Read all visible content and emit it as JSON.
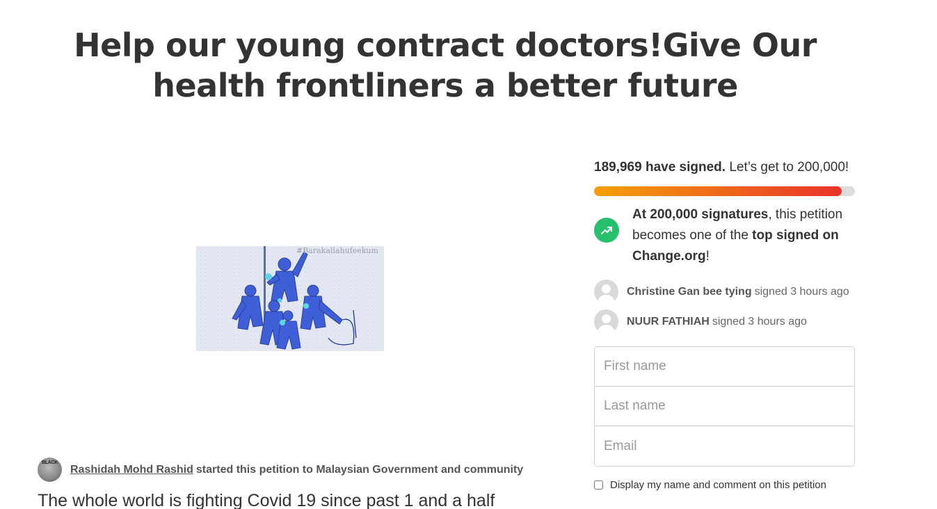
{
  "petition": {
    "title": "Help our young contract doctors!Give Our health frontliners a better future",
    "image_watermark": "#Barakallahufeekum",
    "starter": {
      "avatar_text": "BLACK",
      "name": "Rashidah Mohd Rashid",
      "action_text": "started this petition to Malaysian Government and community"
    },
    "body_preview": "The whole world is fighting Covid 19 since past 1 and a half"
  },
  "progress": {
    "signed_count": "189,969 have signed.",
    "goal_text": "Let’s get to 200,000!",
    "fraction": 0.95,
    "colors": {
      "start": "#f5a00a",
      "end": "#e8332a",
      "track": "#dddddd"
    }
  },
  "milestone": {
    "icon": "trending-up-icon",
    "lead": "At 200,000 signatures",
    "middle": ", this petition becomes one of the",
    "emphasis": "top signed on Change.org",
    "tail": "!",
    "icon_color": "#26bf6e"
  },
  "recent_signers": [
    {
      "name": "Christine Gan bee tying",
      "action": "signed 3 hours ago"
    },
    {
      "name": "NUUR FATHIAH",
      "action": "signed 3 hours ago"
    }
  ],
  "form": {
    "first_name_placeholder": "First name",
    "last_name_placeholder": "Last name",
    "email_placeholder": "Email",
    "display_label": "Display my name and comment on this petition"
  }
}
